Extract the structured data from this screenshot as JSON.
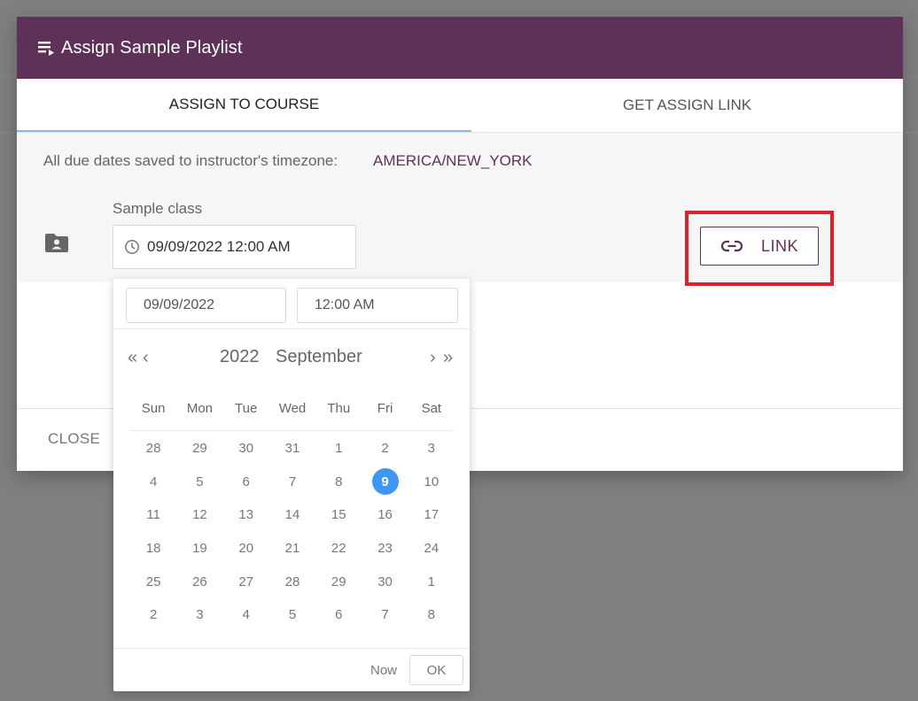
{
  "dialog": {
    "title": "Assign Sample Playlist",
    "header_color": "#5e3258",
    "header_icon": "playlist-play-icon"
  },
  "tabs": [
    {
      "label": "ASSIGN TO COURSE",
      "active": true
    },
    {
      "label": "GET ASSIGN LINK",
      "active": false
    }
  ],
  "timezone": {
    "label": "All due dates saved to instructor's timezone:",
    "value": "AMERICA/NEW_YORK"
  },
  "course": {
    "icon": "folder-account-icon",
    "name": "Sample class",
    "due_date": "09/09/2022 12:00 AM"
  },
  "link_button": {
    "label": "LINK",
    "icon": "link-icon",
    "highlight_color": "#e2202b"
  },
  "footer": {
    "close_label": "CLOSE"
  },
  "picker": {
    "date_input": "09/09/2022",
    "time_input": "12:00 AM",
    "year": "2022",
    "month": "September",
    "nav": {
      "prev_year": "«",
      "prev_month": "‹",
      "next_month": "›",
      "next_year": "»"
    },
    "weekdays": [
      "Sun",
      "Mon",
      "Tue",
      "Wed",
      "Thu",
      "Fri",
      "Sat"
    ],
    "weeks": [
      [
        "28",
        "29",
        "30",
        "31",
        "1",
        "2",
        "3"
      ],
      [
        "4",
        "5",
        "6",
        "7",
        "8",
        "9",
        "10"
      ],
      [
        "11",
        "12",
        "13",
        "14",
        "15",
        "16",
        "17"
      ],
      [
        "18",
        "19",
        "20",
        "21",
        "22",
        "23",
        "24"
      ],
      [
        "25",
        "26",
        "27",
        "28",
        "29",
        "30",
        "1"
      ],
      [
        "2",
        "3",
        "4",
        "5",
        "6",
        "7",
        "8"
      ]
    ],
    "selected_day": "9",
    "selected_color": "#4096f3",
    "now_label": "Now",
    "ok_label": "OK"
  }
}
